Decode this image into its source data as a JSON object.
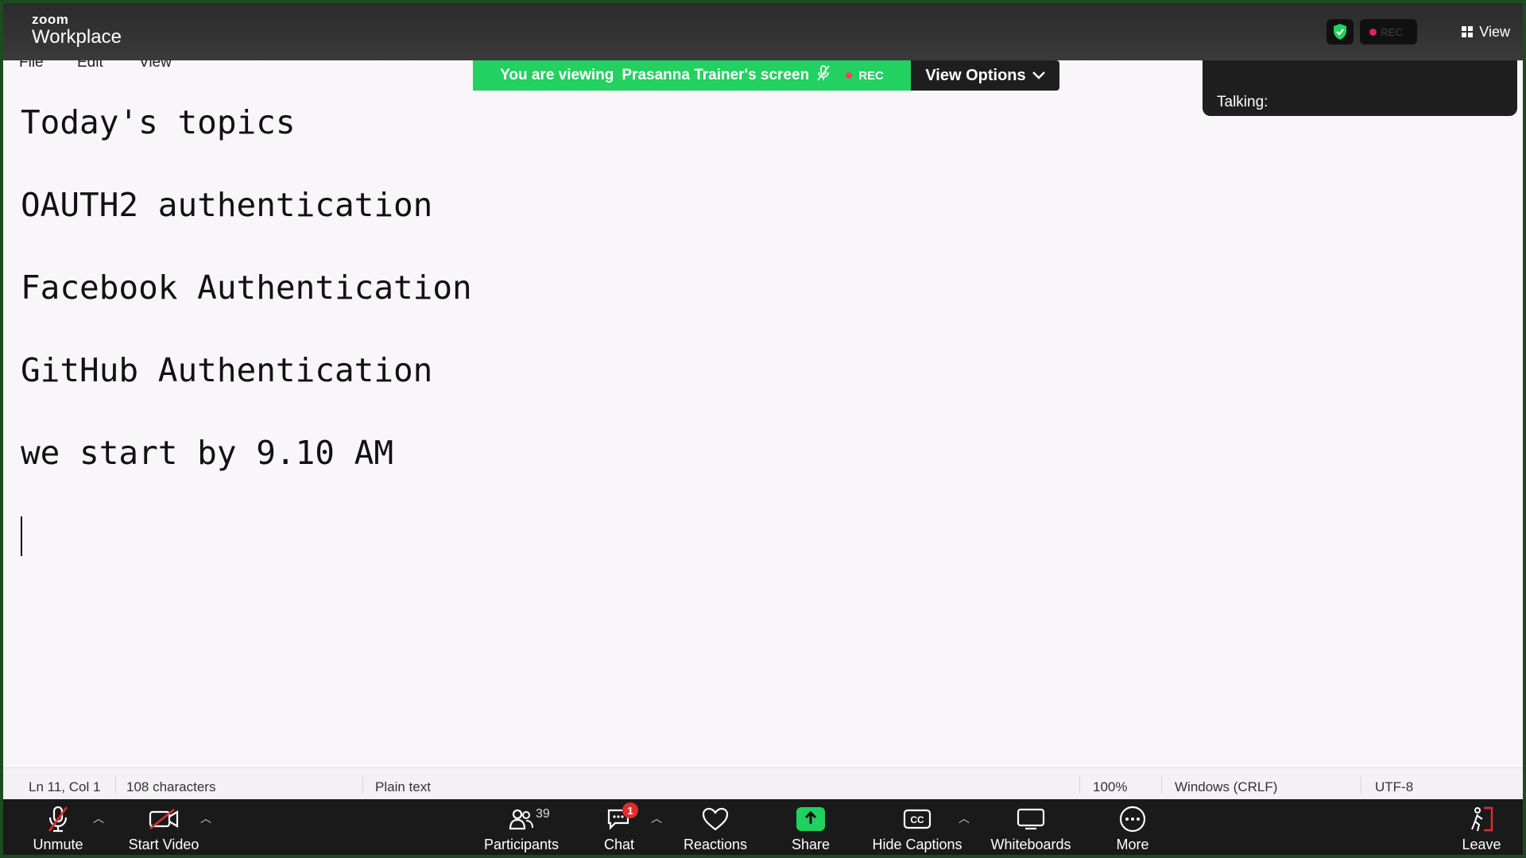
{
  "zoom": {
    "brand_small": "zoom",
    "brand": "Workplace",
    "rec_label": "REC",
    "view_label": "View"
  },
  "notepad": {
    "menu": [
      "File",
      "Edit",
      "View"
    ],
    "lines": [
      "Today's topics",
      "OAUTH2 authentication",
      "Facebook Authentication",
      "GitHub Authentication",
      "we start by 9.10 AM"
    ],
    "status": {
      "position": "Ln 11, Col 1",
      "characters": "108 characters",
      "format": "Plain text",
      "zoom": "100%",
      "line_ending": "Windows (CRLF)",
      "encoding": "UTF-8"
    }
  },
  "banner": {
    "prefix": "You are viewing",
    "name": "Prasanna Trainer's screen",
    "rec": "REC",
    "view_options": "View Options"
  },
  "talking": {
    "label": "Talking:"
  },
  "toolbar": {
    "unmute": "Unmute",
    "start_video": "Start Video",
    "participants": "Participants",
    "participants_count": "39",
    "chat": "Chat",
    "chat_badge": "1",
    "reactions": "Reactions",
    "share": "Share",
    "hide_captions": "Hide Captions",
    "whiteboards": "Whiteboards",
    "more": "More",
    "leave": "Leave"
  },
  "colors": {
    "banner_green": "#23d160",
    "share_green": "#1fd15e",
    "rec_red": "#e0245e",
    "toolbar_bg": "#1a1a1a"
  }
}
